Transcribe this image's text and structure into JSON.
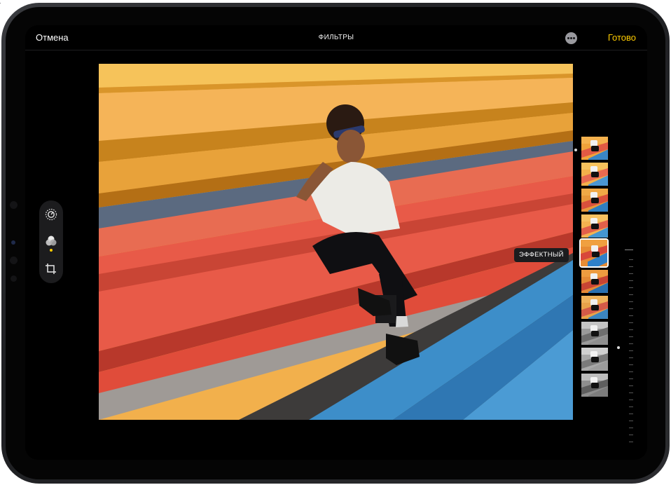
{
  "header": {
    "cancel_label": "Отмена",
    "title": "ФИЛЬТРЫ",
    "more_icon": "ellipsis-circle-icon",
    "done_label": "Готово"
  },
  "tools": [
    {
      "name": "adjust",
      "icon": "adjust-dial-icon",
      "active": false
    },
    {
      "name": "filters",
      "icon": "filters-circles-icon",
      "active": true
    },
    {
      "name": "crop",
      "icon": "crop-rotate-icon",
      "active": false
    }
  ],
  "filters": {
    "selected_index": 4,
    "selected_label": "ЭФФЕКТНЫЙ",
    "thumbnails": [
      "color",
      "color",
      "color",
      "color",
      "color",
      "color",
      "color",
      "mono",
      "mono",
      "mono"
    ]
  },
  "colors": {
    "accent": "#ffcc00",
    "background": "#000000",
    "toolbar": "#1c1c1e"
  }
}
